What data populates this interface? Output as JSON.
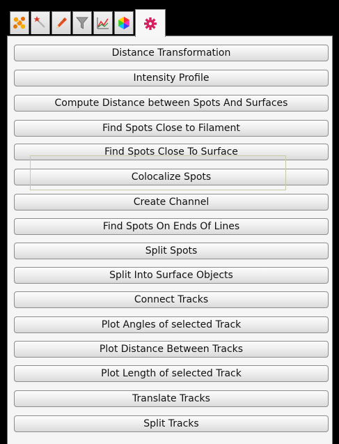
{
  "tabs": [
    {
      "icon": "molecule-icon",
      "color": "#f08a00"
    },
    {
      "icon": "magic-wand-icon",
      "color": "#d93a2a"
    },
    {
      "icon": "pencil-icon",
      "color": "#e05020"
    },
    {
      "icon": "filter-icon",
      "color": "#707070"
    },
    {
      "icon": "statistics-icon",
      "color": "#2a8a3a"
    },
    {
      "icon": "color-wheel-icon",
      "color": "#c040c0"
    },
    {
      "icon": "gear-icon",
      "color": "#d42060",
      "active": true
    }
  ],
  "buttons": [
    {
      "label": "Distance Transformation"
    },
    {
      "label": "Intensity Profile"
    },
    {
      "label": "Compute Distance between Spots And Surfaces"
    },
    {
      "label": "Find Spots Close to Filament"
    },
    {
      "label": "Find Spots Close To Surface"
    },
    {
      "label": "Colocalize Spots"
    },
    {
      "label": "Create Channel"
    },
    {
      "label": "Find Spots On Ends Of Lines"
    },
    {
      "label": "Split Spots"
    },
    {
      "label": "Split Into Surface Objects"
    },
    {
      "label": "Connect Tracks"
    },
    {
      "label": "Plot Angles of selected Track"
    },
    {
      "label": "Plot Distance Between Tracks"
    },
    {
      "label": "Plot Length of selected Track"
    },
    {
      "label": "Translate Tracks"
    },
    {
      "label": "Split Tracks"
    }
  ]
}
